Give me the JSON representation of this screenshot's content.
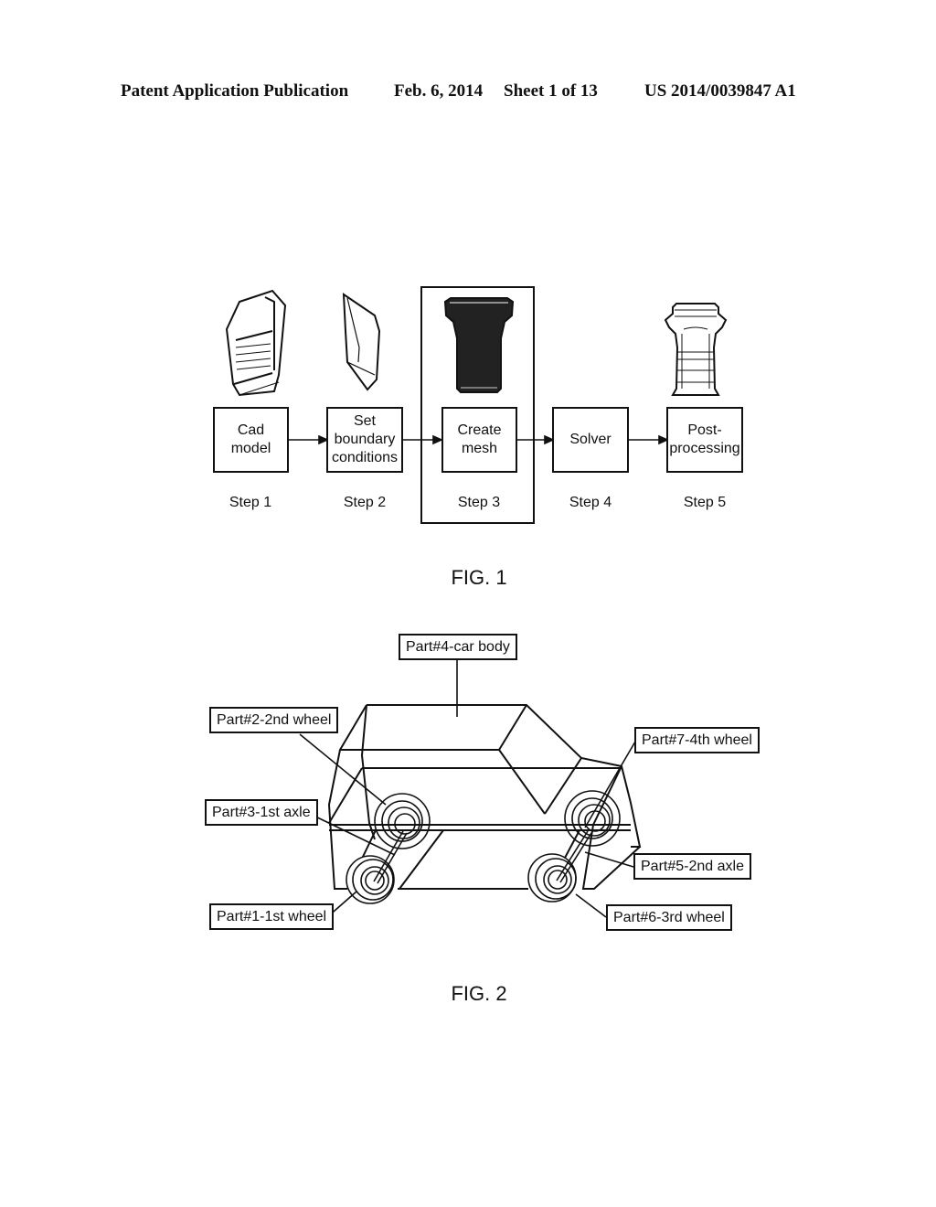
{
  "header": {
    "publication": "Patent Application Publication",
    "date": "Feb. 6, 2014",
    "sheet": "Sheet 1 of 13",
    "number": "US 2014/0039847 A1"
  },
  "fig1": {
    "caption": "FIG. 1",
    "highlighted_step": 3,
    "steps": [
      {
        "label_lines": [
          "Cad",
          "model"
        ],
        "step": "Step 1",
        "icon": "cad-part-icon"
      },
      {
        "label_lines": [
          "Set",
          "boundary",
          "conditions"
        ],
        "step": "Step 2",
        "icon": "boundary-part-icon"
      },
      {
        "label_lines": [
          "Create",
          "mesh"
        ],
        "step": "Step 3",
        "icon": "meshed-part-icon"
      },
      {
        "label_lines": [
          "Solver"
        ],
        "step": "Step 4",
        "icon": null
      },
      {
        "label_lines": [
          "Post-",
          "processing"
        ],
        "step": "Step 5",
        "icon": "result-part-icon"
      }
    ]
  },
  "fig2": {
    "caption": "FIG. 2",
    "labels": {
      "car_body": "Part#4-car body",
      "wheel2": "Part#2-2nd wheel",
      "axle1": "Part#3-1st axle",
      "wheel1": "Part#1-1st wheel",
      "wheel4": "Part#7-4th wheel",
      "axle2": "Part#5-2nd axle",
      "wheel3": "Part#6-3rd wheel"
    }
  }
}
